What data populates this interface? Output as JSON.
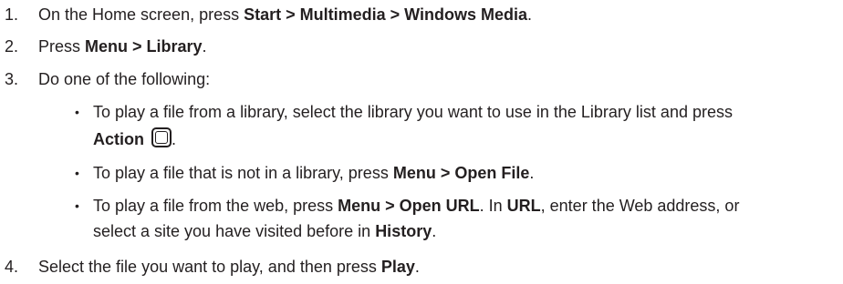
{
  "steps": [
    {
      "number": "1.",
      "prefix": "On the Home screen, press ",
      "bold": "Start > Multimedia > Windows Media",
      "suffix": "."
    },
    {
      "number": "2.",
      "prefix": "Press ",
      "bold": "Menu > Library",
      "suffix": "."
    },
    {
      "number": "3.",
      "text": "Do one of the following:"
    },
    {
      "number": "4.",
      "prefix": "Select the file you want to play, and then press ",
      "bold": "Play",
      "suffix": "."
    }
  ],
  "options": [
    {
      "bullet": "•",
      "line1": "To play a file from a library, select the library you want to use in the Library list and press",
      "bold": "Action",
      "icon": "action-button-icon",
      "suffix": "."
    },
    {
      "bullet": "•",
      "prefix": "To play a file that is not in a library, press ",
      "bold": "Menu > Open File",
      "suffix": "."
    },
    {
      "bullet": "•",
      "prefix": "To play a file from the web, press ",
      "bold1": "Menu > Open URL",
      "middle": ". In ",
      "bold2": "URL",
      "suffix1": ", enter the Web address, or",
      "line2_prefix": "select a site you have visited before in ",
      "bold3": "History",
      "suffix2": "."
    }
  ]
}
